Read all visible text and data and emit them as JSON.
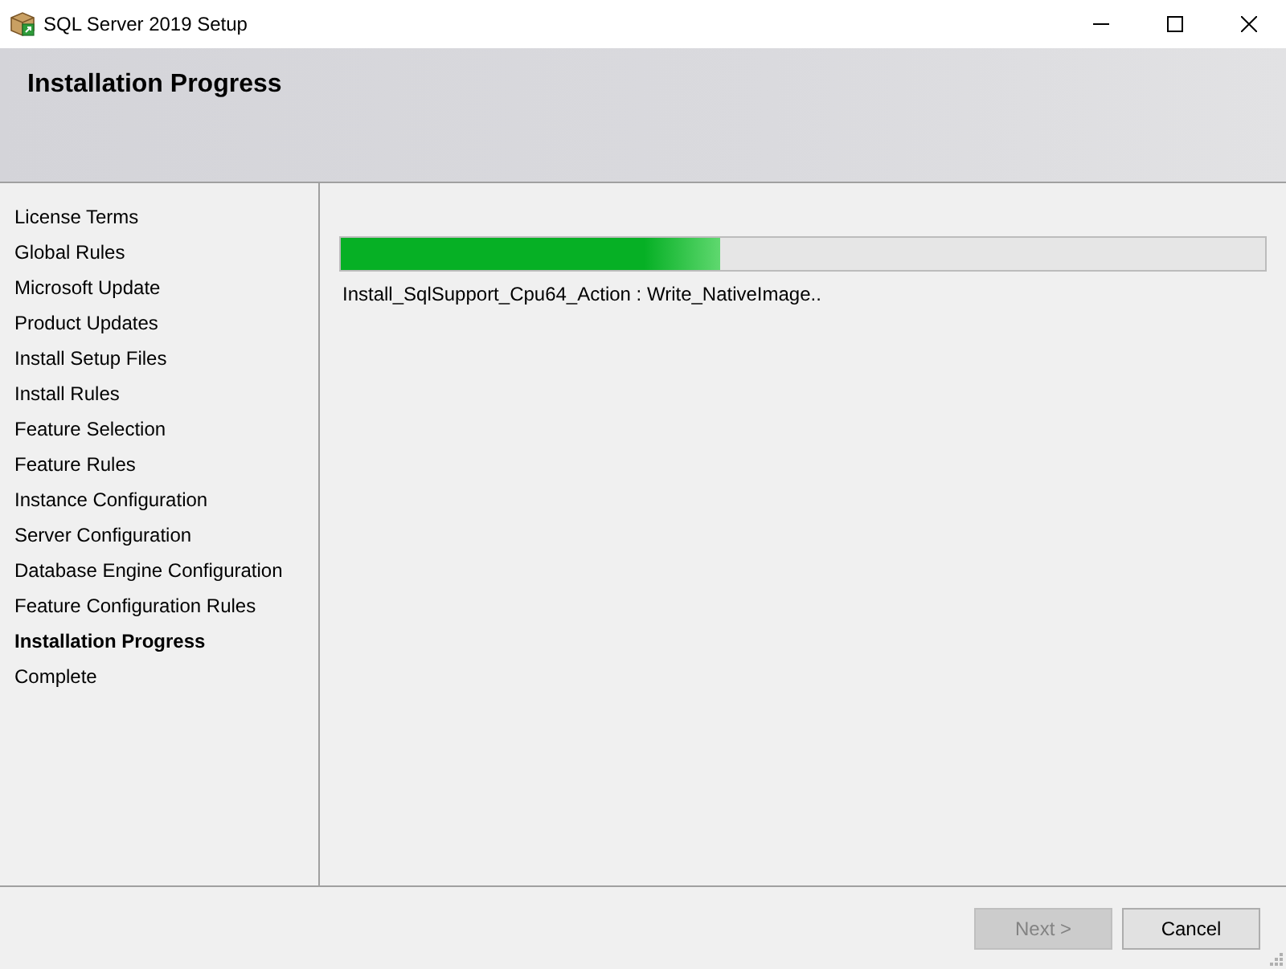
{
  "window": {
    "title": "SQL Server 2019 Setup"
  },
  "header": {
    "title": "Installation Progress"
  },
  "steps": [
    {
      "label": "License Terms",
      "selected": false
    },
    {
      "label": "Global Rules",
      "selected": false
    },
    {
      "label": "Microsoft Update",
      "selected": false
    },
    {
      "label": "Product Updates",
      "selected": false
    },
    {
      "label": "Install Setup Files",
      "selected": false
    },
    {
      "label": "Install Rules",
      "selected": false
    },
    {
      "label": "Feature Selection",
      "selected": false
    },
    {
      "label": "Feature Rules",
      "selected": false
    },
    {
      "label": "Instance Configuration",
      "selected": false
    },
    {
      "label": "Server Configuration",
      "selected": false
    },
    {
      "label": "Database Engine Configuration",
      "selected": false
    },
    {
      "label": "Feature Configuration Rules",
      "selected": false
    },
    {
      "label": "Installation Progress",
      "selected": true
    },
    {
      "label": "Complete",
      "selected": false
    }
  ],
  "progress": {
    "level": 0.41,
    "status": "Install_SqlSupport_Cpu64_Action : Write_NativeImage.."
  },
  "buttons": [
    {
      "label": "Next >",
      "disabled": true
    },
    {
      "label": "Cancel",
      "disabled": false
    }
  ]
}
